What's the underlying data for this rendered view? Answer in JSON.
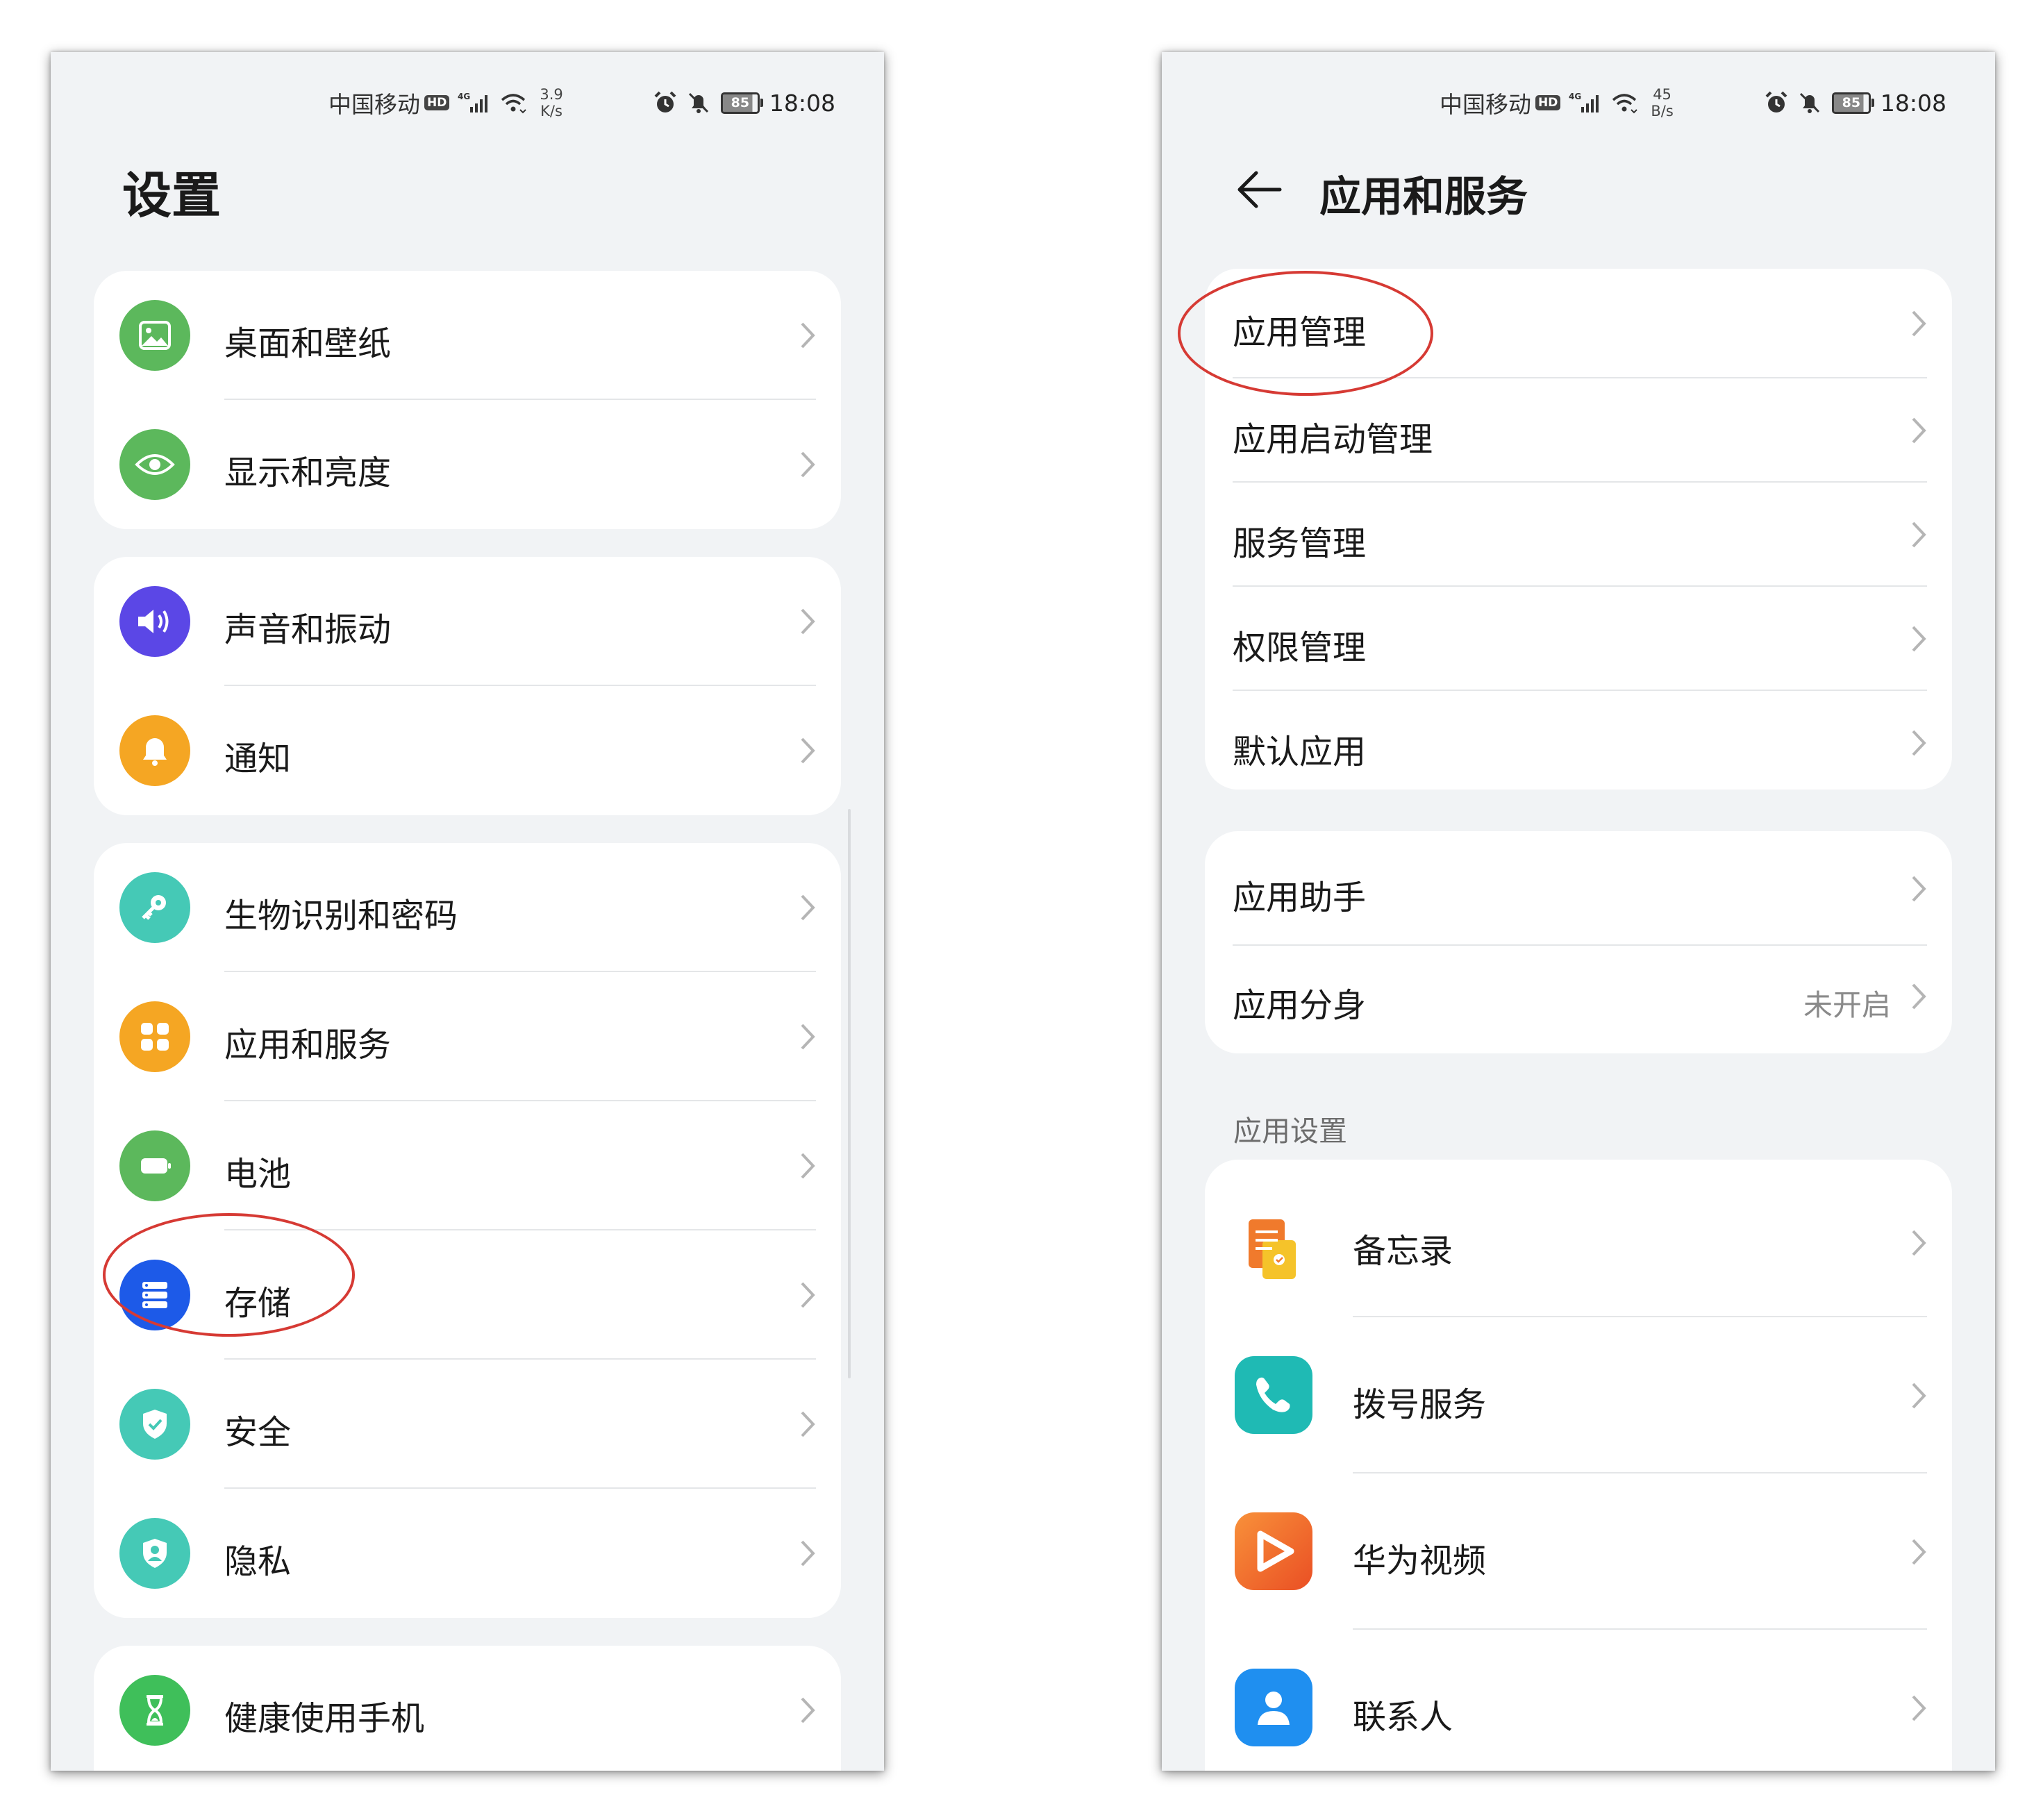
{
  "left_phone": {
    "status_bar": {
      "carrier": "中国移动",
      "hd": "HD",
      "network": "4G",
      "speed_value": "3.9",
      "speed_unit": "K/s",
      "battery": "85",
      "time": "18:08"
    },
    "title": "设置",
    "groups": [
      {
        "items": [
          {
            "label": "桌面和壁纸",
            "icon": "image-icon",
            "color": "#5cb85c"
          },
          {
            "label": "显示和亮度",
            "icon": "eye-icon",
            "color": "#5cb85c"
          }
        ]
      },
      {
        "items": [
          {
            "label": "声音和振动",
            "icon": "speaker-icon",
            "color": "#5b47e6"
          },
          {
            "label": "通知",
            "icon": "bell-icon",
            "color": "#f5a623"
          }
        ]
      },
      {
        "items": [
          {
            "label": "生物识别和密码",
            "icon": "key-icon",
            "color": "#45c9b6"
          },
          {
            "label": "应用和服务",
            "icon": "grid-icon",
            "color": "#f5a623"
          },
          {
            "label": "电池",
            "icon": "battery-icon",
            "color": "#5cb85c"
          },
          {
            "label": "存储",
            "icon": "storage-icon",
            "color": "#1d5ae8"
          },
          {
            "label": "安全",
            "icon": "shield-check-icon",
            "color": "#45c9b6"
          },
          {
            "label": "隐私",
            "icon": "privacy-shield-icon",
            "color": "#45c9b6"
          }
        ]
      },
      {
        "items": [
          {
            "label": "健康使用手机",
            "icon": "hourglass-icon",
            "color": "#3fbf5a"
          }
        ]
      }
    ],
    "highlighted_item": "存储"
  },
  "right_phone": {
    "status_bar": {
      "carrier": "中国移动",
      "hd": "HD",
      "network": "4G",
      "speed_value": "45",
      "speed_unit": "B/s",
      "battery": "85",
      "time": "18:08"
    },
    "title": "应用和服务",
    "group1": [
      "应用管理",
      "应用启动管理",
      "服务管理",
      "权限管理",
      "默认应用"
    ],
    "group2": [
      {
        "label": "应用助手",
        "value": ""
      },
      {
        "label": "应用分身",
        "value": "未开启"
      }
    ],
    "section_header": "应用设置",
    "apps": [
      {
        "label": "备忘录",
        "icon": "notepad-icon"
      },
      {
        "label": "拨号服务",
        "icon": "phone-icon",
        "color": "#1fbab4"
      },
      {
        "label": "华为视频",
        "icon": "video-play-icon",
        "color": "#f06a2c"
      },
      {
        "label": "联系人",
        "icon": "contact-icon",
        "color": "#1f8ff0"
      }
    ],
    "highlighted_item": "应用管理"
  },
  "colors": {
    "highlight": "#d63a34",
    "page_bg": "#f1f3f5",
    "card_bg": "#ffffff"
  }
}
